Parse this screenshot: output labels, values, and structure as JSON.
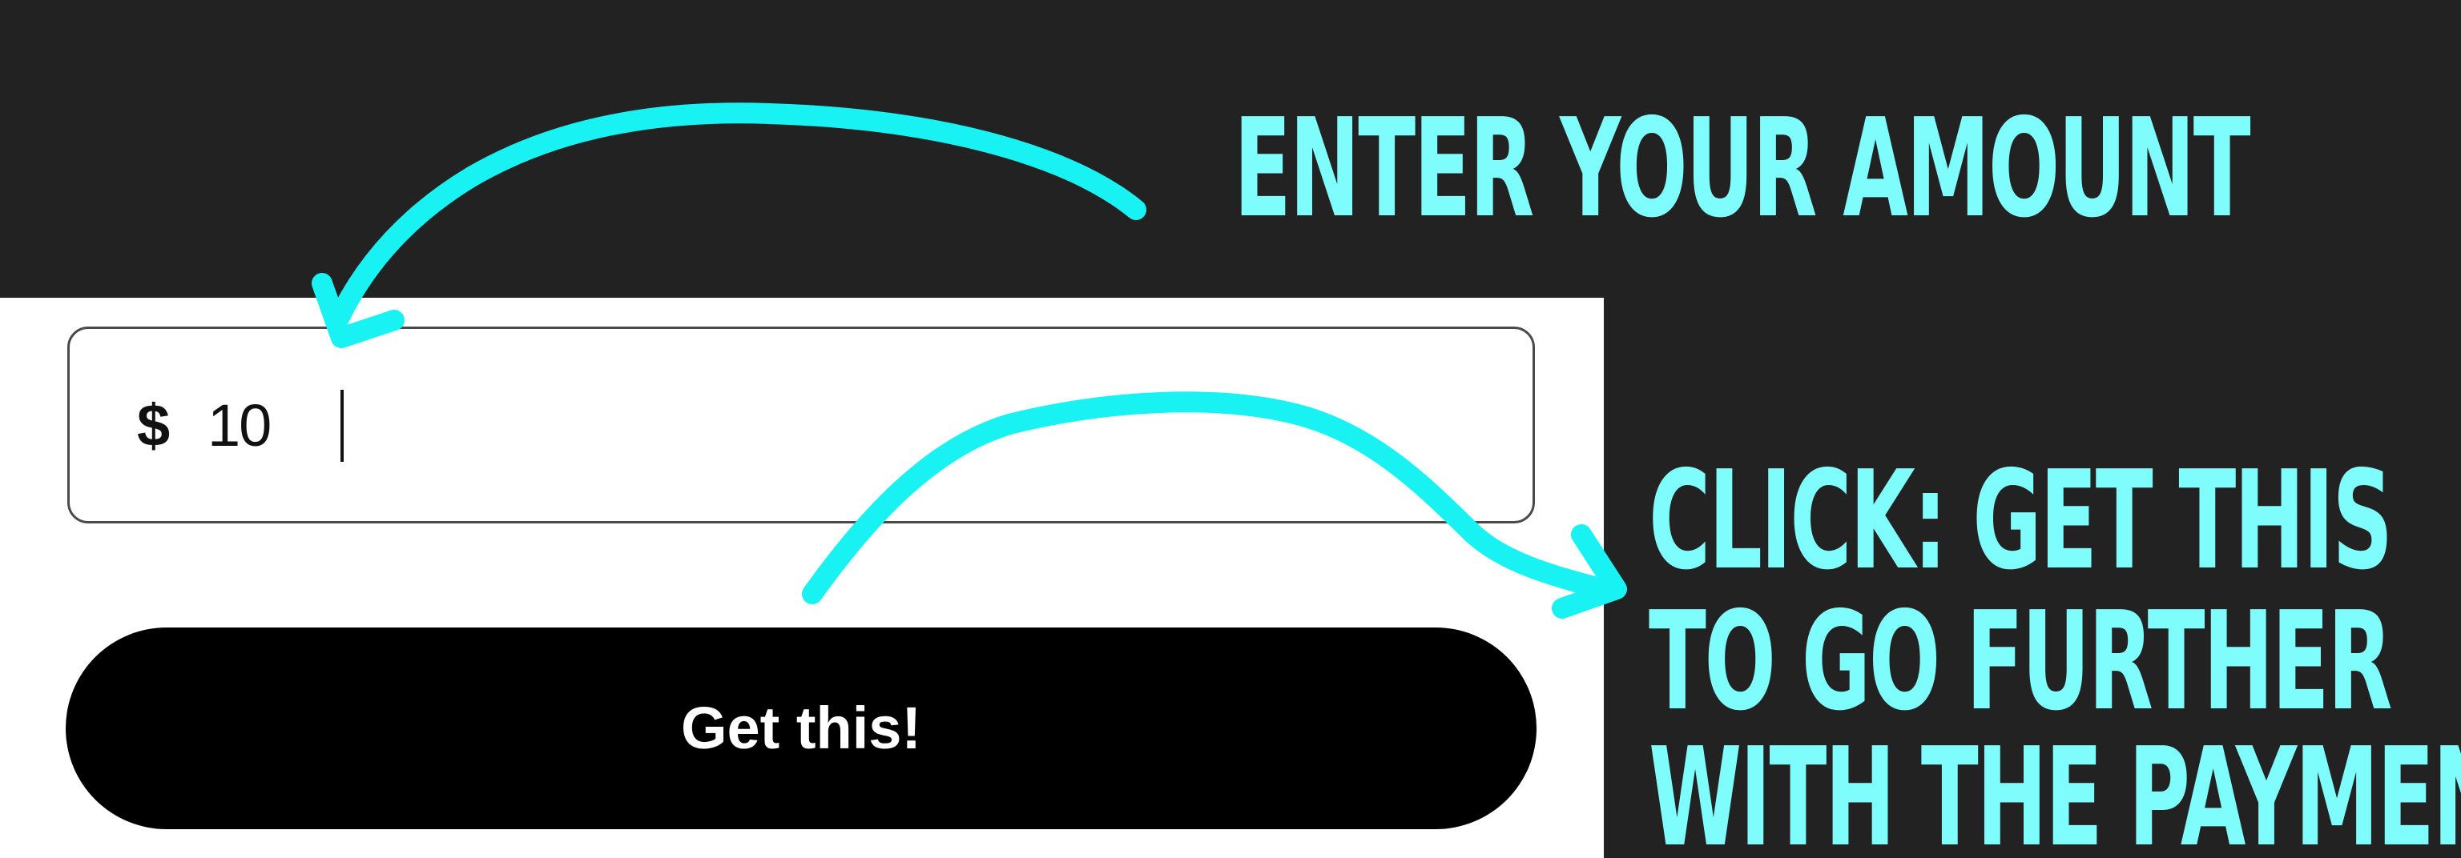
{
  "annotations": {
    "top_note": "ENTER YOUR AMOUNT",
    "bottom_note": {
      "line1": "CLICK: GET THIS",
      "line2": "TO GO FURTHER",
      "line3": "WITH THE PAYMENT"
    },
    "color": "#7ffcfc"
  },
  "form": {
    "currency_symbol": "$",
    "amount_value": "10",
    "submit_label": "Get this!"
  },
  "colors": {
    "background": "#222222",
    "panel": "#ffffff",
    "button": "#000000",
    "arrow": "#19f2f2"
  }
}
